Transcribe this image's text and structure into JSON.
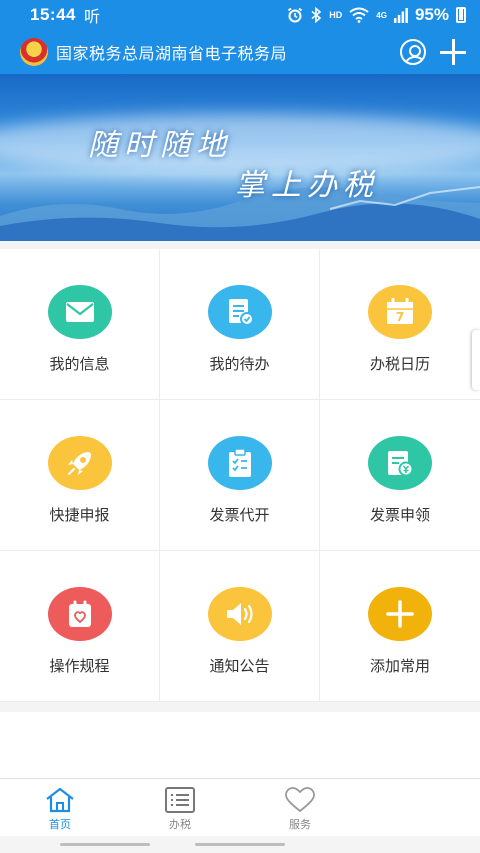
{
  "status_bar": {
    "time": "15:44",
    "extra": "听",
    "hd_label": "HD",
    "signal_label": "4G",
    "battery": "95%"
  },
  "app_bar": {
    "title": "国家税务总局湖南省电子税务局",
    "icons": [
      "emblem-icon",
      "user-icon",
      "plus-icon"
    ]
  },
  "banner": {
    "line1": "随时随地",
    "line2": "掌上办税"
  },
  "grid": [
    {
      "label": "我的信息",
      "icon": "mail-icon",
      "color": "#2fc6a5"
    },
    {
      "label": "我的待办",
      "icon": "todo-icon",
      "color": "#39b6ec"
    },
    {
      "label": "办税日历",
      "icon": "calendar-icon",
      "color": "#fbc43d",
      "icon_text": "7"
    },
    {
      "label": "快捷申报",
      "icon": "rocket-icon",
      "color": "#fbc43d"
    },
    {
      "label": "发票代开",
      "icon": "clipboard-icon",
      "color": "#39b6ec"
    },
    {
      "label": "发票申领",
      "icon": "invoice-icon",
      "color": "#2fc6a5"
    },
    {
      "label": "操作规程",
      "icon": "guide-icon",
      "color": "#ee5b5b"
    },
    {
      "label": "通知公告",
      "icon": "speaker-icon",
      "color": "#fbc43d"
    },
    {
      "label": "添加常用",
      "icon": "add-icon",
      "color": "#f1b20c"
    }
  ],
  "tabs": [
    {
      "label": "首页",
      "icon": "home-icon",
      "active": true
    },
    {
      "label": "办税",
      "icon": "list-icon",
      "active": false
    },
    {
      "label": "服务",
      "icon": "heart-icon",
      "active": false
    }
  ],
  "colors": {
    "primary": "#1c8ee6"
  }
}
